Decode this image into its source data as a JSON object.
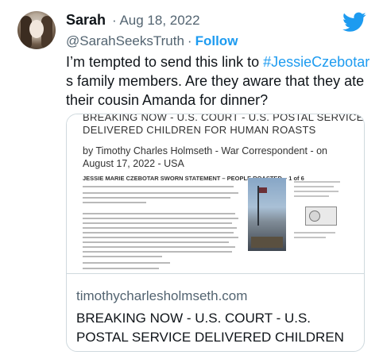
{
  "tweet": {
    "author_name": "Sarah",
    "date": "· Aug 18, 2022",
    "handle": "@SarahSeeksTruth",
    "separator": "·",
    "follow_label": "Follow",
    "text_before": "I’m tempted to send this link to ",
    "hashtag": "#JessieCzebotar",
    "text_after": " s family members. Are they aware that they ate their cousin Amanda for dinner?"
  },
  "card": {
    "image": {
      "headline_line1": "BREAKING NOW - U.S. COURT - U.S. POSTAL SERVICE",
      "headline_line2": "DELIVERED CHILDREN FOR HUMAN ROASTS",
      "byline": "by Timothy Charles Holmseth - War Correspondent - on August 17, 2022 - USA",
      "doc_title": "JESSIE MARIE CZEBOTAR SWORN STATEMENT – PEOPLE ROASTED – 1 of 6"
    },
    "domain": "timothycharlesholmseth.com",
    "title": "BREAKING NOW - U.S. COURT - U.S. POSTAL SERVICE DELIVERED CHILDREN FOR HUMAN..."
  },
  "icons": {
    "brand": "twitter-bird-icon",
    "brand_color": "#1d9bf0"
  }
}
